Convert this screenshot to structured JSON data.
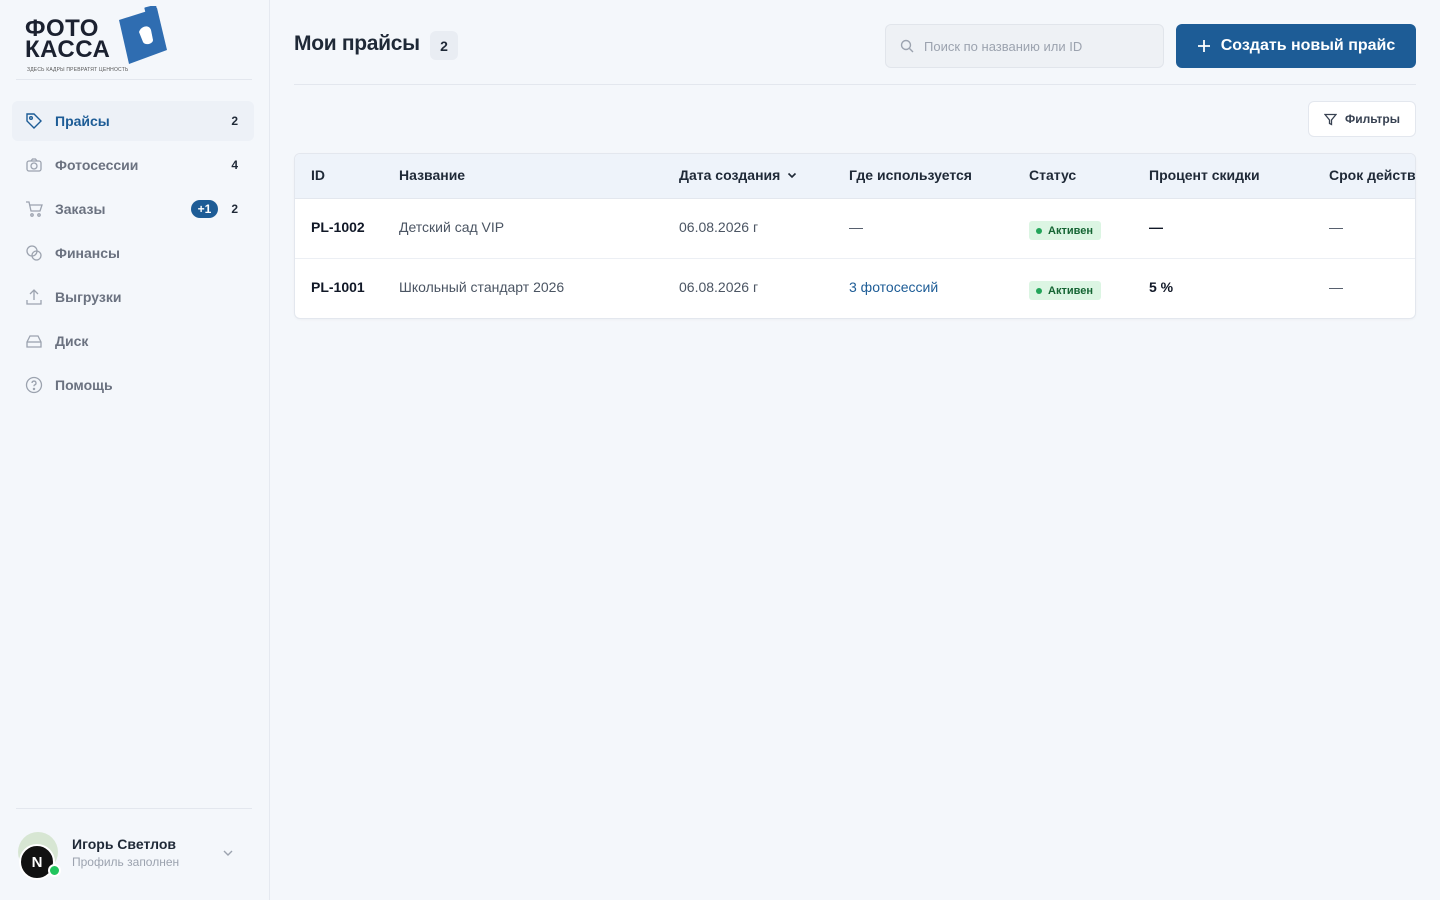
{
  "brand": {
    "name_line1": "ФОТО",
    "name_line2": "КАССА",
    "tagline": "ЗДЕСЬ КАДРЫ ПРЕВРАТЯТ ЦЕННОСТЬ"
  },
  "sidebar": {
    "items": [
      {
        "label": "Прайсы",
        "count": "2",
        "icon": "tag-icon",
        "active": true
      },
      {
        "label": "Фотосессии",
        "count": "4",
        "icon": "camera-icon"
      },
      {
        "label": "Заказы",
        "count": "2",
        "badge": "+1",
        "icon": "cart-icon"
      },
      {
        "label": "Финансы",
        "icon": "coins-icon"
      },
      {
        "label": "Выгрузки",
        "icon": "upload-icon"
      },
      {
        "label": "Диск",
        "icon": "disk-icon"
      },
      {
        "label": "Помощь",
        "icon": "help-icon"
      }
    ]
  },
  "profile": {
    "name": "Игорь Светлов",
    "status": "Профиль заполнен",
    "avatar_letter": "N"
  },
  "header": {
    "title": "Мои прайсы",
    "count": "2",
    "search_placeholder": "Поиск по названию или ID",
    "create_label": "Создать новый прайс",
    "filter_label": "Фильтры"
  },
  "table": {
    "columns": [
      "ID",
      "Название",
      "Дата создания",
      "Где используется",
      "Статус",
      "Процент скидки",
      "Срок действия"
    ],
    "rows": [
      {
        "id": "PL-1002",
        "name": "Детский сад VIP",
        "date": "06.08.2026 г",
        "used_in": "—",
        "status": "Активен",
        "discount": "—",
        "term": "—"
      },
      {
        "id": "PL-1001",
        "name": "Школьный стандарт 2026",
        "date": "06.08.2026 г",
        "used_in": "3 фотосессий",
        "status": "Активен",
        "discount": "5 %",
        "term": "—"
      }
    ]
  },
  "colors": {
    "accent": "#1d5c96",
    "status_active_bg": "#dcf5e3",
    "status_active_text": "#166534"
  }
}
